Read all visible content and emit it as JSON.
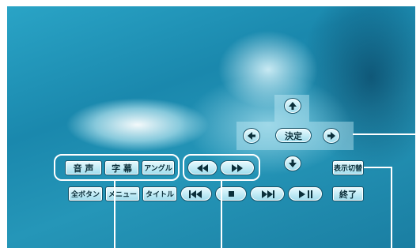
{
  "buttons": {
    "audio": "音 声",
    "subtitle": "字 幕",
    "angle": "アングル",
    "all_buttons": "全ボタン",
    "menu": "メニュー",
    "title": "タイトル",
    "enter": "決定",
    "display_switch": "表示切替",
    "quit": "終了"
  },
  "icons": {
    "up": "arrow-up-icon",
    "down": "arrow-down-icon",
    "left": "arrow-left-icon",
    "right": "arrow-right-icon",
    "rewind": "rewind-icon",
    "fast_forward": "fast-forward-icon",
    "previous": "skip-previous-icon",
    "stop": "stop-icon",
    "next": "skip-next-icon",
    "play_pause": "play-pause-icon"
  },
  "colors": {
    "overlay": "#1e93b8",
    "button_face": "#c8f0fa",
    "button_border": "#16546a",
    "callout": "#ffffff"
  }
}
